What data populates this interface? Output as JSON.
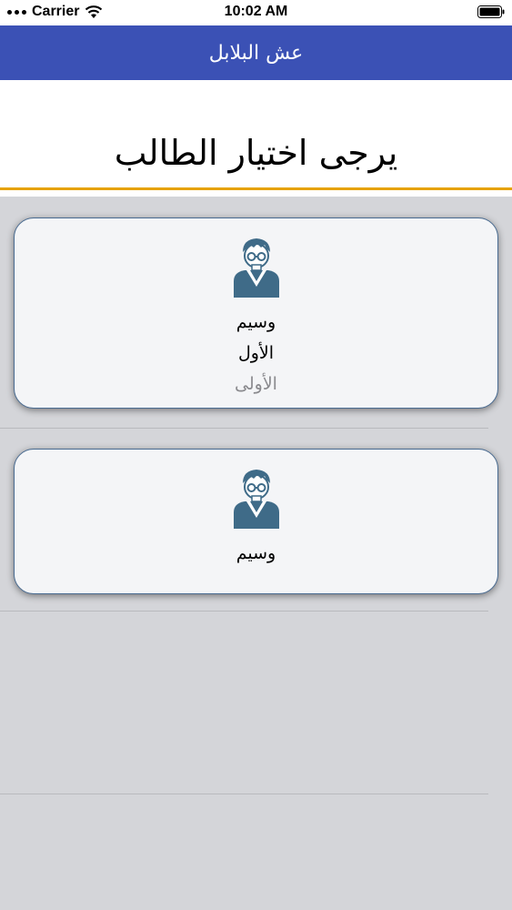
{
  "status_bar": {
    "carrier": "Carrier",
    "time": "10:02 AM"
  },
  "nav": {
    "title": "عش البلابل"
  },
  "page": {
    "title": "يرجى اختيار الطالب"
  },
  "students": [
    {
      "name": "وسيم",
      "line2": "الأول",
      "line3": "الأولى",
      "icon": "student-avatar-icon"
    },
    {
      "name": "وسيم",
      "icon": "student-avatar-icon"
    }
  ],
  "colors": {
    "nav_bar": "#3b51b5",
    "accent_underline": "#e6a200",
    "card_border": "#4a6c92",
    "background": "#d4d5d9",
    "avatar": "#3f6b88"
  }
}
